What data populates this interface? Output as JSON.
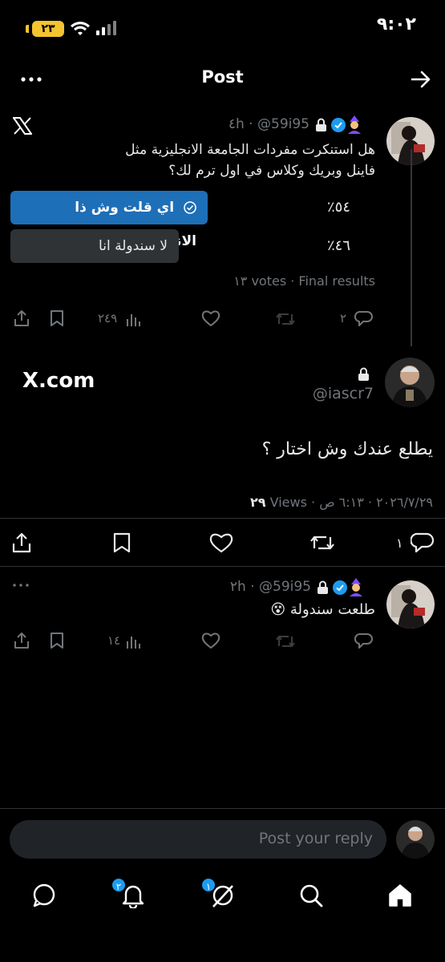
{
  "status_bar": {
    "time": "٩:٠٢",
    "battery": "٢٣"
  },
  "header": {
    "title": "Post"
  },
  "parent_post": {
    "handle": "@59i95",
    "age": "٤h",
    "text": "هل استنكرت مفردات الجامعة الانجليزية مثل فاينل وبريك وكلاس في اول ترم لك؟",
    "poll": {
      "options": [
        {
          "label": "اي قلت وش ذا الانهزام",
          "percent": "٥٤٪",
          "share": 0.54,
          "winner": true
        },
        {
          "label": "لا سندولة انا",
          "percent": "٤٦٪",
          "share": 0.46,
          "winner": false
        }
      ],
      "summary": "١٣ votes · Final results"
    },
    "actions": {
      "replies": "٢",
      "views": "٢٤٩"
    }
  },
  "main_post": {
    "source_label": "X.com",
    "handle": "@iascr7",
    "text": "يطلع عندك وش اختار ؟",
    "datetime": "٢٠٢٦/٧/٢٩ · ٦:١٣ ص ·",
    "views_count": "٢٩",
    "views_label": "Views",
    "actions": {
      "replies": "١"
    }
  },
  "reply_post": {
    "handle": "@59i95",
    "age": "٢h",
    "text": "طلعت سندولة 😵",
    "actions": {
      "views": "١٤"
    }
  },
  "composer": {
    "placeholder": "Post your reply"
  },
  "bottom_nav": {
    "notifications_badge": "٢",
    "grok_badge": "١"
  },
  "colors": {
    "accent": "#1d9bf0",
    "poll_winner": "#1d6fb8",
    "background": "#000000"
  }
}
